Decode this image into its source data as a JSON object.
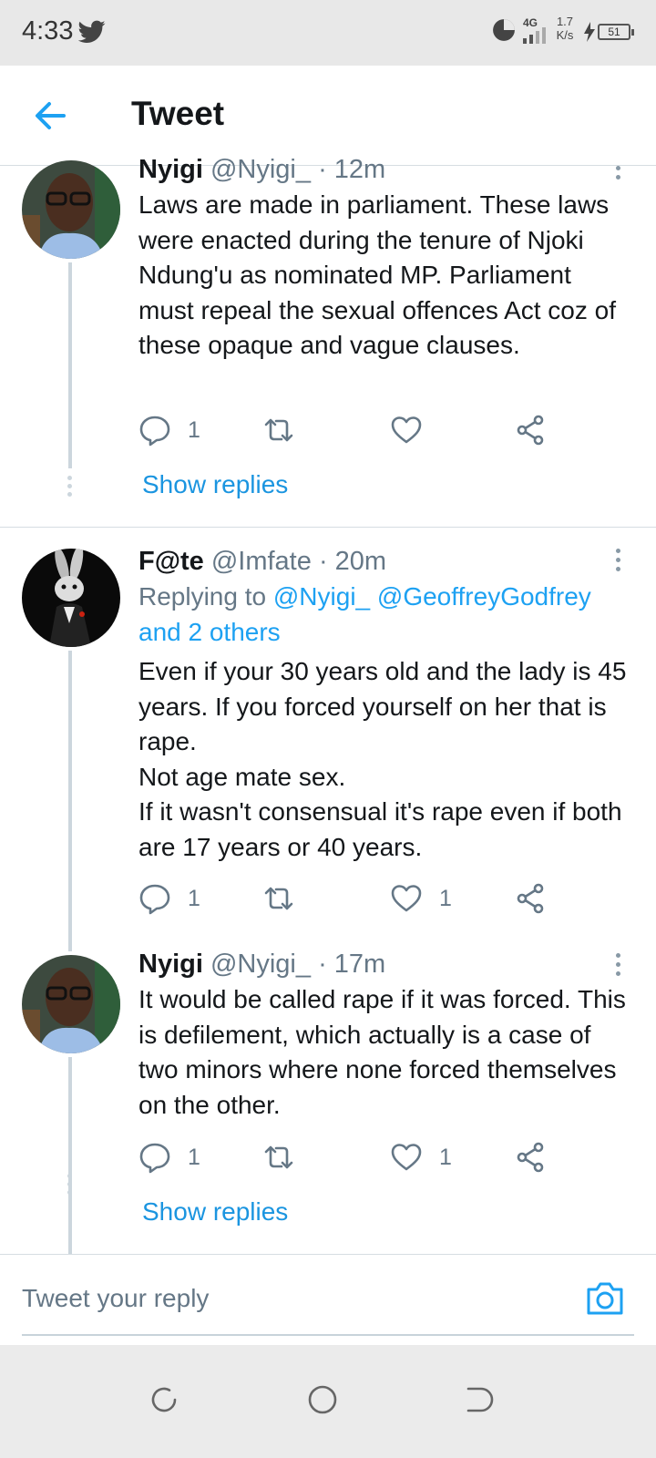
{
  "status_bar": {
    "time": "4:33",
    "network": "4G",
    "speed_value": "1.7",
    "speed_unit": "K/s",
    "battery": "51"
  },
  "header": {
    "title": "Tweet"
  },
  "tweets": [
    {
      "name": "Nyigi",
      "handle": "@Nyigi_",
      "time": "12m",
      "text": "Laws are made in parliament. These laws were enacted during the tenure of Njoki Ndung'u as nominated MP. Parliament must repeal the sexual offences Act coz of these opaque and vague clauses.",
      "replies": "1",
      "retweets": "",
      "likes": "",
      "show_replies": "Show replies"
    },
    {
      "name": "F@te",
      "handle": "@Imfate",
      "time": "20m",
      "replying_prefix": "Replying to",
      "replying_to_1": "@Nyigi_",
      "replying_to_2": "@GeoffreyGodfrey",
      "replying_others": "and 2 others",
      "text": "Even if your 30 years old and the lady is 45 years. If you forced yourself on her that is rape.\nNot age mate sex.\nIf it wasn't consensual it's rape even if both are 17 years or 40 years.",
      "replies": "1",
      "retweets": "",
      "likes": "1"
    },
    {
      "name": "Nyigi",
      "handle": "@Nyigi_",
      "time": "17m",
      "text": "It would be called rape if it was forced. This is defilement, which actually is a case of two minors where none forced themselves on the other.",
      "replies": "1",
      "retweets": "",
      "likes": "1",
      "show_replies": "Show replies"
    }
  ],
  "reply_bar": {
    "placeholder": "Tweet your reply"
  },
  "colors": {
    "accent": "#1da1f2",
    "secondary_text": "#657786",
    "thread_line": "#ccd6dd"
  }
}
